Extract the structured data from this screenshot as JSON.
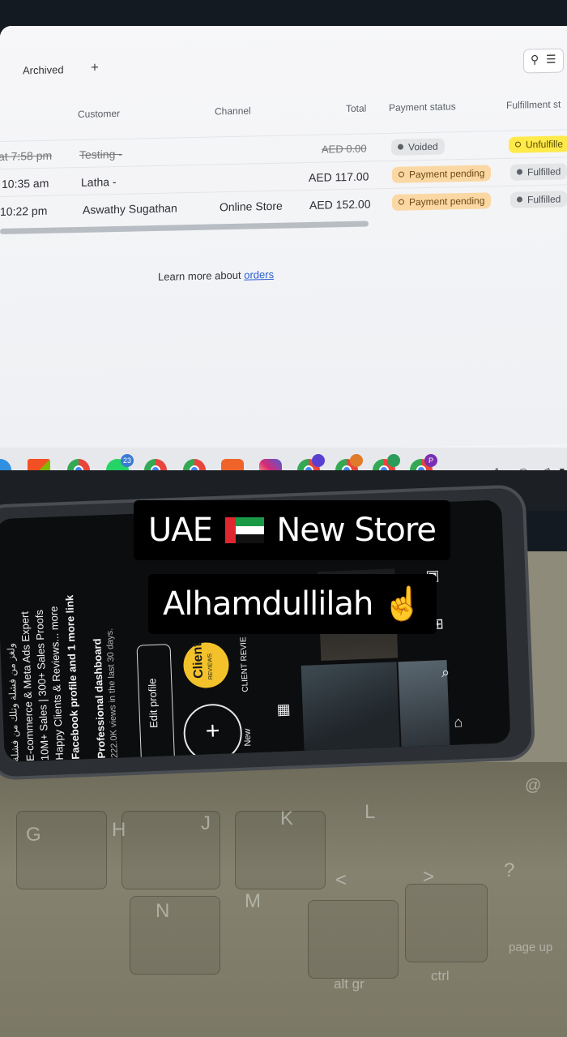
{
  "orders": {
    "tabs": {
      "archived": "Archived",
      "add": "+"
    },
    "search_icon": "search-icon",
    "filter_icon": "filter-icon",
    "columns": {
      "date": "",
      "customer": "Customer",
      "channel": "Channel",
      "total": "Total",
      "payment_status": "Payment status",
      "fulfillment_status": "Fulfillment st"
    },
    "rows": [
      {
        "date": "at 7:58 pm",
        "customer": "Testing -",
        "channel": "",
        "total": "AED 0.00",
        "payment": "Voided",
        "fulfillment": "Unfulfille"
      },
      {
        "date": "10:35 am",
        "customer": "Latha -",
        "channel": "",
        "total": "AED 117.00",
        "payment": "Payment pending",
        "fulfillment": "Fulfilled"
      },
      {
        "date": "10:22 pm",
        "customer": "Aswathy Sugathan",
        "channel": "Online Store",
        "total": "AED 152.00",
        "payment": "Payment pending",
        "fulfillment": "Fulfilled"
      }
    ],
    "learn_more": {
      "prefix": "Learn more about ",
      "link": "orders"
    }
  },
  "taskbar": {
    "badges": {
      "whatsapp": "23",
      "chrome_profile_1": "",
      "chrome_profile_2": "",
      "chrome_profile_3": "",
      "chrome_profile_4": "P"
    },
    "tray": {
      "chevron": "^",
      "wifi": "wifi-icon",
      "volume": "volume-icon"
    }
  },
  "phone": {
    "bio_arabic": "ولغز من فشلة وتلك من فشلة",
    "bio_line1": "E-commerce & Meta Ads Expert",
    "bio_line2": "10M+ Sales | 300+ Sales Proofs",
    "bio_line3": "Happy Clients & Reviews... more",
    "bio_link": "Facebook profile and 1 more link",
    "dashboard_title": "Professional dashboard",
    "dashboard_sub": "222.0K views in the last 30 days.",
    "edit_profile": "Edit profile",
    "new_label": "New",
    "client_label": "Client",
    "client_sub": "REVIEWS",
    "highlight_label": "CLIENT REVIE"
  },
  "keyboard": {
    "keys": [
      "G",
      "H",
      "J",
      "K",
      "L",
      "N",
      "M",
      "<",
      ">",
      "?",
      "@",
      "alt gr",
      "ctrl",
      "page up"
    ]
  },
  "story": {
    "caption1_before": "UAE",
    "caption1_after": "New Store",
    "caption2_text": "Alhamdullilah",
    "caption2_emoji": "☝️"
  }
}
